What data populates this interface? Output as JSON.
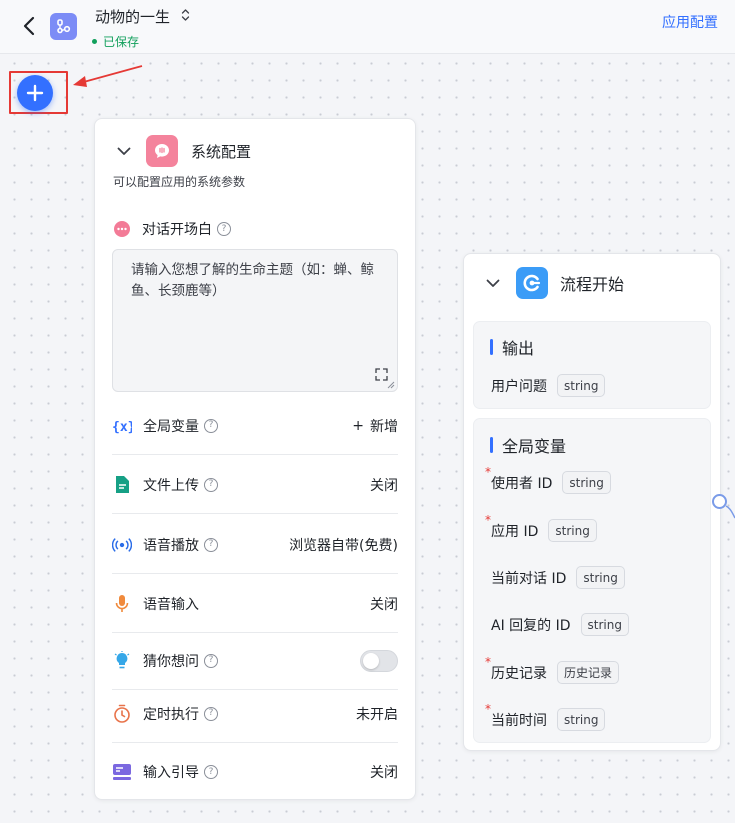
{
  "header": {
    "app_name": "动物的一生",
    "status": "已保存",
    "app_config": "应用配置"
  },
  "colors": {
    "accent": "#3370ff",
    "saved": "#12a05c",
    "highlight": "#e53935"
  },
  "system_config": {
    "title": "系统配置",
    "description": "可以配置应用的系统参数",
    "opening": {
      "label": "对话开场白",
      "placeholder": "请输入您想了解的生命主题（如：蝉、鲸鱼、长颈鹿等）"
    },
    "rows": [
      {
        "label": "全局变量",
        "value": "新增",
        "icon": "variable-icon"
      },
      {
        "label": "文件上传",
        "value": "关闭",
        "icon": "file-icon"
      },
      {
        "label": "语音播放",
        "value": "浏览器自带(免费)",
        "icon": "broadcast-icon"
      },
      {
        "label": "语音输入",
        "value": "关闭",
        "icon": "microphone-icon"
      },
      {
        "label": "猜你想问",
        "value": "",
        "icon": "lightbulb-icon",
        "toggle_on": false
      },
      {
        "label": "定时执行",
        "value": "未开启",
        "icon": "timer-icon"
      },
      {
        "label": "输入引导",
        "value": "关闭",
        "icon": "input-guide-icon"
      }
    ]
  },
  "flow_start": {
    "title": "流程开始",
    "output": {
      "title": "输出",
      "fields": [
        {
          "name": "用户问题",
          "type": "string",
          "required": false
        }
      ]
    },
    "global_vars": {
      "title": "全局变量",
      "fields": [
        {
          "name": "使用者 ID",
          "type": "string",
          "required": true
        },
        {
          "name": "应用 ID",
          "type": "string",
          "required": true
        },
        {
          "name": "当前对话 ID",
          "type": "string",
          "required": false
        },
        {
          "name": "AI 回复的 ID",
          "type": "string",
          "required": false
        },
        {
          "name": "历史记录",
          "type": "历史记录",
          "required": true
        },
        {
          "name": "当前时间",
          "type": "string",
          "required": true
        }
      ]
    }
  }
}
